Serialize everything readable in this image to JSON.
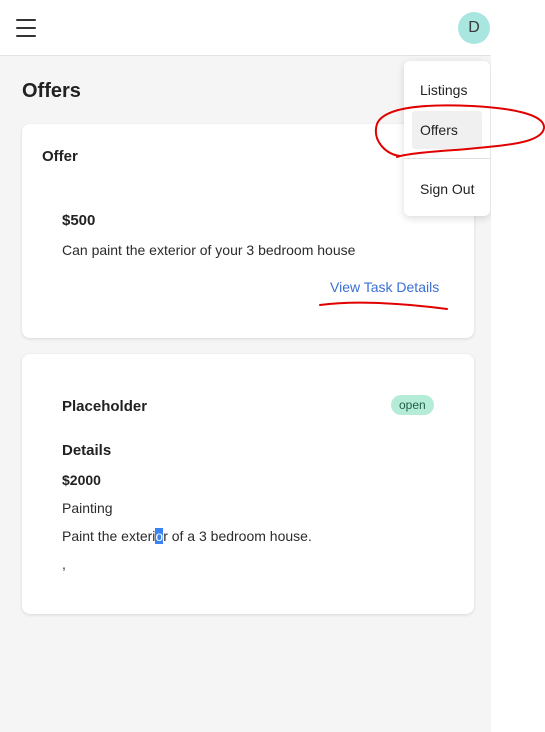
{
  "header": {
    "menu_icon": "hamburger-menu-icon",
    "avatar_initial": "D",
    "avatar_color": "#a8e6df"
  },
  "page": {
    "title": "Offers"
  },
  "offer_card": {
    "heading": "Offer",
    "amount": "$500",
    "description": "Can paint the exterior of your 3 bedroom house",
    "link_label": "View Task Details"
  },
  "task_card": {
    "title": "Placeholder",
    "status": "open",
    "details_heading": "Details",
    "price": "$2000",
    "category": "Painting",
    "description_before": "Paint the exteri",
    "description_selected": "o",
    "description_after": "r of a 3 bedroom house.",
    "extra": ","
  },
  "dropdown": {
    "items": [
      {
        "label": "Listings"
      },
      {
        "label": "Offers"
      },
      {
        "label": "Sign Out"
      }
    ]
  },
  "colors": {
    "link": "#3b6fd4",
    "badge_bg": "#b4ecd7",
    "annotation": "#e00000",
    "selection": "#3b82f6"
  }
}
